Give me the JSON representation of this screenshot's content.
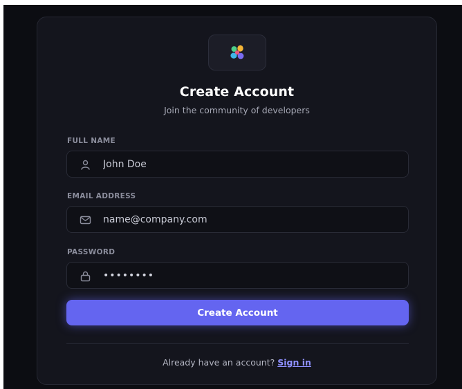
{
  "header": {
    "logo_icon": "four-petal-flower-icon",
    "title": "Create Account",
    "subtitle": "Join the community of developers"
  },
  "form": {
    "full_name": {
      "label": "FULL NAME",
      "icon": "user-icon",
      "value": "",
      "placeholder": "John Doe"
    },
    "email": {
      "label": "EMAIL ADDRESS",
      "icon": "mail-icon",
      "value": "",
      "placeholder": "name@company.com"
    },
    "password": {
      "label": "PASSWORD",
      "icon": "lock-icon",
      "value": "••••••••"
    },
    "submit_label": "Create Account"
  },
  "footer": {
    "prompt": "Already have an account?",
    "link_label": "Sign in"
  },
  "colors": {
    "background": "#0c0d12",
    "card": "#14151d",
    "accent": "#6465f0",
    "link": "#8f91ff",
    "logo_petals": [
      "#f5b536",
      "#e8577f",
      "#3fb6e8",
      "#4fd08a",
      "#7a6cf2"
    ]
  }
}
